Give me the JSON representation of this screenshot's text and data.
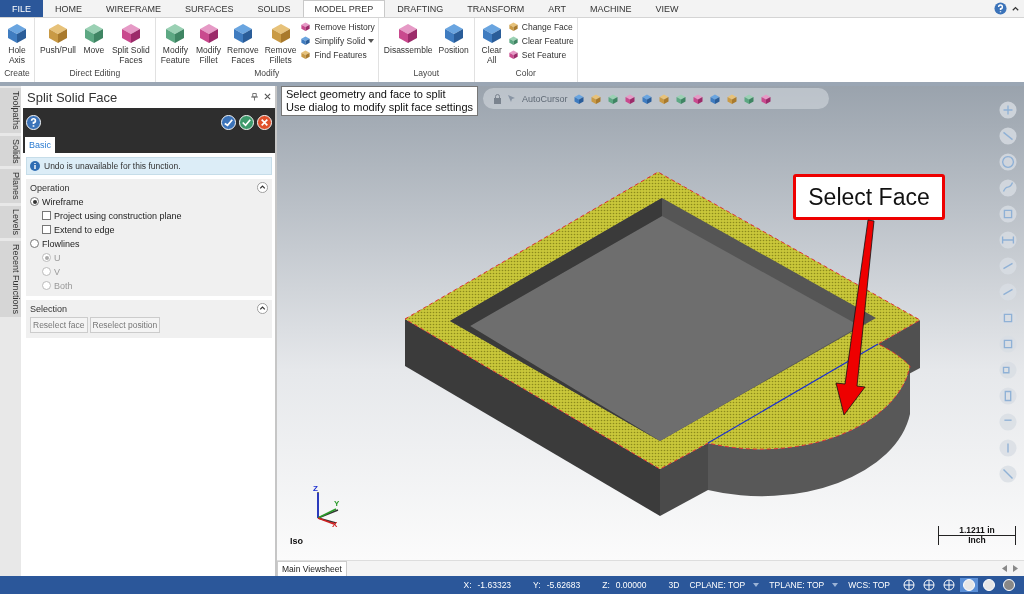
{
  "ribbon_tabs": [
    {
      "label": "FILE",
      "kind": "file",
      "selected": false
    },
    {
      "label": "HOME",
      "kind": "tab",
      "selected": false
    },
    {
      "label": "WIREFRAME",
      "kind": "tab",
      "selected": false
    },
    {
      "label": "SURFACES",
      "kind": "tab",
      "selected": false
    },
    {
      "label": "SOLIDS",
      "kind": "tab",
      "selected": false
    },
    {
      "label": "MODEL PREP",
      "kind": "tab",
      "selected": true
    },
    {
      "label": "DRAFTING",
      "kind": "tab",
      "selected": false
    },
    {
      "label": "TRANSFORM",
      "kind": "tab",
      "selected": false
    },
    {
      "label": "ART",
      "kind": "tab",
      "selected": false
    },
    {
      "label": "MACHINE",
      "kind": "tab",
      "selected": false
    },
    {
      "label": "VIEW",
      "kind": "tab",
      "selected": false
    }
  ],
  "ribbon_groups": [
    {
      "label": "Create",
      "items": [
        {
          "kind": "large",
          "label": "Hole\nAxis"
        }
      ]
    },
    {
      "label": "Direct Editing",
      "items": [
        {
          "kind": "large",
          "label": "Push/Pull"
        },
        {
          "kind": "large",
          "label": "Move"
        },
        {
          "kind": "large",
          "label": "Split Solid\nFaces"
        }
      ]
    },
    {
      "label": "Modify",
      "items": [
        {
          "kind": "large",
          "label": "Modify\nFeature"
        },
        {
          "kind": "large",
          "label": "Modify\nFillet"
        },
        {
          "kind": "large",
          "label": "Remove\nFaces"
        },
        {
          "kind": "large",
          "label": "Remove\nFillets"
        },
        {
          "kind": "small",
          "label": "Remove History"
        },
        {
          "kind": "small",
          "label": "Simplify Solid",
          "dropdown": true
        },
        {
          "kind": "small",
          "label": "Find Features"
        }
      ]
    },
    {
      "label": "Layout",
      "items": [
        {
          "kind": "large",
          "label": "Disassemble"
        },
        {
          "kind": "large",
          "label": "Position"
        }
      ]
    },
    {
      "label": "Color",
      "items": [
        {
          "kind": "large",
          "label": "Clear\nAll"
        },
        {
          "kind": "small",
          "label": "Change Face"
        },
        {
          "kind": "small",
          "label": "Clear Feature"
        },
        {
          "kind": "small",
          "label": "Set Feature"
        }
      ]
    }
  ],
  "side_tabs": [
    "Toolpaths",
    "Solids",
    "Planes",
    "Levels",
    "Recent Functions"
  ],
  "panel": {
    "title": "Split Solid Face",
    "tabs": [
      {
        "label": "Basic",
        "selected": true
      }
    ],
    "info": "Undo is unavailable for this function.",
    "sections": [
      {
        "title": "Operation",
        "expanded": true,
        "kind": "options",
        "items": [
          {
            "kind": "radio",
            "label": "Wireframe",
            "selected": true,
            "disabled": false,
            "children": [
              {
                "kind": "checkbox",
                "label": "Project using construction plane",
                "checked": false
              },
              {
                "kind": "checkbox",
                "label": "Extend to edge",
                "checked": false
              }
            ]
          },
          {
            "kind": "radio",
            "label": "Flowlines",
            "selected": false,
            "disabled": false,
            "children": [
              {
                "kind": "radio",
                "label": "U",
                "selected": true,
                "disabled": true
              },
              {
                "kind": "radio",
                "label": "V",
                "selected": false,
                "disabled": true
              },
              {
                "kind": "radio",
                "label": "Both",
                "selected": false,
                "disabled": true
              }
            ]
          }
        ]
      },
      {
        "title": "Selection",
        "expanded": true,
        "kind": "buttons",
        "buttons": [
          "Reselect face",
          "Reselect position"
        ]
      }
    ]
  },
  "viewport": {
    "prompt": [
      "Select geometry and face to split",
      "Use dialog to modify split face settings"
    ],
    "autocursor": "AutoCursor",
    "callout": "Select Face",
    "axes": [
      "Z",
      "Y",
      "X"
    ],
    "view_label": "Iso",
    "scale": {
      "value": "1.1211 in",
      "unit": "Inch"
    }
  },
  "viewsheet_tabs": [
    {
      "label": "Main Viewsheet",
      "selected": true
    }
  ],
  "status_bar": {
    "coords": [
      {
        "label": "X:",
        "value": "-1.63323"
      },
      {
        "label": "Y:",
        "value": "-5.62683"
      },
      {
        "label": "Z:",
        "value": "0.00000"
      }
    ],
    "planes": [
      {
        "label": "3D",
        "dropdown": false
      },
      {
        "label": "CPLANE: TOP",
        "dropdown": true
      },
      {
        "label": "TPLANE: TOP",
        "dropdown": true
      },
      {
        "label": "WCS: TOP",
        "dropdown": false
      }
    ],
    "display_modes": [
      {
        "selected": false
      },
      {
        "selected": false
      },
      {
        "selected": false
      },
      {
        "selected": true
      },
      {
        "selected": false
      },
      {
        "selected": false
      }
    ]
  }
}
